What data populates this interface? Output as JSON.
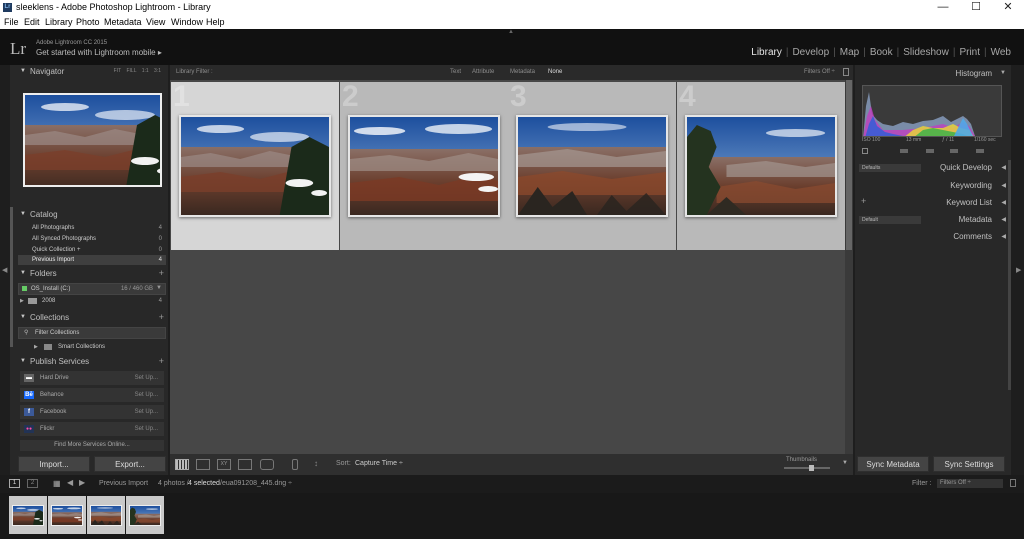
{
  "window": {
    "title": "sleeklens - Adobe Photoshop Lightroom - Library",
    "app_icon": "Lr",
    "minimize": "—",
    "maximize": "☐",
    "close": "✕"
  },
  "menu": [
    "File",
    "Edit",
    "Library",
    "Photo",
    "Metadata",
    "View",
    "Window",
    "Help"
  ],
  "identity": {
    "logo": "Lr",
    "version": "Adobe Lightroom CC 2015",
    "get_started": "Get started with Lightroom mobile ▸"
  },
  "modules": [
    {
      "label": "Library",
      "active": true
    },
    {
      "label": "Develop",
      "active": false
    },
    {
      "label": "Map",
      "active": false
    },
    {
      "label": "Book",
      "active": false
    },
    {
      "label": "Slideshow",
      "active": false
    },
    {
      "label": "Print",
      "active": false
    },
    {
      "label": "Web",
      "active": false
    }
  ],
  "navigator": {
    "title": "Navigator",
    "zoom": [
      "FIT",
      "FILL",
      "1:1",
      "3:1"
    ]
  },
  "catalog": {
    "title": "Catalog",
    "items": [
      {
        "label": "All Photographs",
        "count": "4"
      },
      {
        "label": "All Synced Photographs",
        "count": "0"
      },
      {
        "label": "Quick Collection +",
        "count": "0"
      },
      {
        "label": "Previous Import",
        "count": "4"
      }
    ]
  },
  "folders": {
    "title": "Folders",
    "volume": "OS_Install (C:)",
    "volume_space": "16 / 460 GB",
    "folder": "2008",
    "folder_count": "4"
  },
  "collections": {
    "title": "Collections",
    "filter": "Filter Collections",
    "smart": "Smart Collections"
  },
  "publish": {
    "title": "Publish Services",
    "services": [
      {
        "name": "Hard Drive",
        "action": "Set Up...",
        "icon": "▬",
        "color": "#666666"
      },
      {
        "name": "Behance",
        "action": "Set Up...",
        "icon": "Bē",
        "color": "#1769ff"
      },
      {
        "name": "Facebook",
        "action": "Set Up...",
        "icon": "f",
        "color": "#3b5998"
      },
      {
        "name": "Flickr",
        "action": "Set Up...",
        "icon": "●●",
        "color": "#223355"
      }
    ],
    "more": "Find More Services Online..."
  },
  "left_buttons": {
    "import": "Import...",
    "export": "Export..."
  },
  "filter_bar": {
    "label": "Library Filter :",
    "text": "Text",
    "attribute": "Attribute",
    "metadata": "Metadata",
    "none": "None",
    "filters_off": "Filters Off ÷"
  },
  "grid": {
    "cells": [
      {
        "number": "1",
        "selected": true
      },
      {
        "number": "2",
        "selected": false
      },
      {
        "number": "3",
        "selected": false
      },
      {
        "number": "4",
        "selected": false
      }
    ]
  },
  "toolbar": {
    "sort_label": "Sort:",
    "sort_value": "Capture Time ÷",
    "thumbnails": "Thumbnails",
    "thumbnail_size": 0.62
  },
  "histogram": {
    "title": "Histogram",
    "iso": "ISO 100",
    "focal": "13 mm",
    "aperture": "ƒ / 11",
    "shutter": "1/160 sec"
  },
  "right_panels": {
    "quick_develop": "Quick Develop",
    "defaults": "Defaults",
    "keywording": "Keywording",
    "keyword_list": "Keyword List",
    "metadata": "Metadata",
    "default": "Default",
    "comments": "Comments"
  },
  "right_buttons": {
    "sync_metadata": "Sync Metadata",
    "sync_settings": "Sync Settings"
  },
  "filmstrip": {
    "source": "Previous Import",
    "count": "4 photos /",
    "selected": "4 selected",
    "file": "/eua091208_445.dng ÷",
    "filter_label": "Filter :",
    "filter_value": "Filters Off ÷"
  }
}
